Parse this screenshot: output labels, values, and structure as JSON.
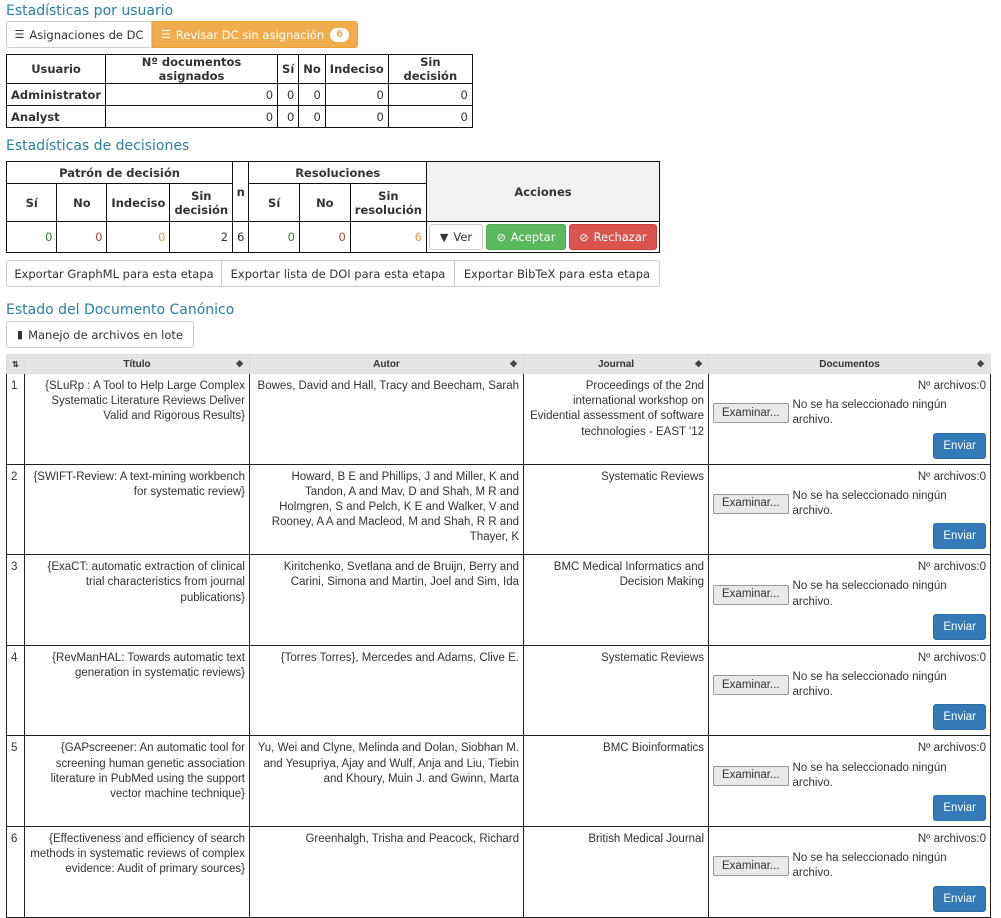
{
  "user_stats": {
    "heading": "Estadísticas por usuario",
    "btn_assignments": "Asignaciones de DC",
    "btn_review": "Revisar DC sin asignación",
    "review_badge": "6",
    "columns": [
      "Usuario",
      "Nº documentos asignados",
      "Sí",
      "No",
      "Indeciso",
      "Sin decisión"
    ],
    "rows": [
      [
        "Administrator",
        "0",
        "0",
        "0",
        "0",
        "0"
      ],
      [
        "Analyst",
        "0",
        "0",
        "0",
        "0",
        "0"
      ]
    ]
  },
  "decision_stats": {
    "heading": "Estadísticas de decisiones",
    "group_pattern": "Patrón de decisión",
    "col_n": "n",
    "group_resolutions": "Resoluciones",
    "col_actions": "Acciones",
    "sub_pattern": [
      "Sí",
      "No",
      "Indeciso",
      "Sin decisión"
    ],
    "sub_resolutions": [
      "Sí",
      "No",
      "Sin resolución"
    ],
    "values": {
      "p_si": "0",
      "p_no": "0",
      "p_indeciso": "0",
      "p_sin": "2",
      "n": "6",
      "r_si": "0",
      "r_no": "0",
      "r_sin": "6"
    },
    "btn_ver": "Ver",
    "btn_accept": "Aceptar",
    "btn_reject": "Rechazar",
    "export_graphml": "Exportar GraphML para esta etapa",
    "export_doi": "Exportar lista de DOI para esta etapa",
    "export_bibtex": "Exportar BibTeX para esta etapa"
  },
  "canonical": {
    "heading": "Estado del Documento Canónico",
    "btn_batch": "Manejo de archivos en lote",
    "columns": {
      "title": "Título",
      "author": "Autor",
      "journal": "Journal",
      "documents": "Documentos"
    },
    "file_count_label": "Nº archivos:0",
    "browse_label": "Examinar...",
    "no_file_label": "No se ha seleccionado ningún archivo.",
    "send_label": "Enviar",
    "rows": [
      {
        "idx": "1",
        "title": "{SLuRp : A Tool to Help Large Complex Systematic Literature Reviews Deliver Valid and Rigorous Results}",
        "author": "Bowes, David and Hall, Tracy and Beecham, Sarah",
        "journal": "Proceedings of the 2nd international workshop on Evidential assessment of software technologies - EAST '12"
      },
      {
        "idx": "2",
        "title": "{SWIFT-Review: A text-mining workbench for systematic review}",
        "author": "Howard, B E and Phillips, J and Miller, K and Tandon, A and Mav, D and Shah, M R and Holmgren, S and Pelch, K E and Walker, V and Rooney, A A and Macleod, M and Shah, R R and Thayer, K",
        "journal": "Systematic Reviews"
      },
      {
        "idx": "3",
        "title": "{ExaCT: automatic extraction of clinical trial characteristics from journal publications}",
        "author": "Kiritchenko, Svetlana and de Bruijn, Berry and Carini, Simona and Martin, Joel and Sim, Ida",
        "journal": "BMC Medical Informatics and Decision Making"
      },
      {
        "idx": "4",
        "title": "{RevManHAL: Towards automatic text generation in systematic reviews}",
        "author": "{Torres Torres}, Mercedes and Adams, Clive E.",
        "journal": "Systematic Reviews"
      },
      {
        "idx": "5",
        "title": "{GAPscreener: An automatic tool for screening human genetic association literature in PubMed using the support vector machine technique}",
        "author": "Yu, Wei and Clyne, Melinda and Dolan, Siobhan M. and Yesupriya, Ajay and Wulf, Anja and Liu, Tiebin and Khoury, Muin J. and Gwinn, Marta",
        "journal": "BMC Bioinformatics"
      },
      {
        "idx": "6",
        "title": "{Effectiveness and efficiency of search methods in systematic reviews of complex evidence: Audit of primary sources}",
        "author": "Greenhalgh, Trisha and Peacock, Richard",
        "journal": "British Medical Journal"
      }
    ]
  }
}
